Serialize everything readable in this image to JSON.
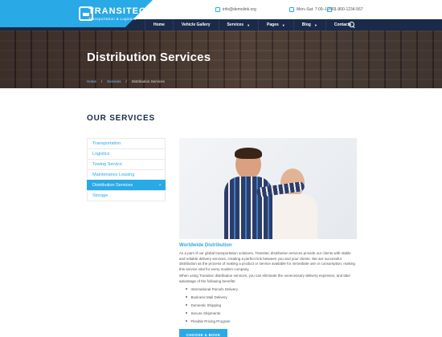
{
  "brand": {
    "name": "TRANSITEC",
    "tagline": "Transportation & Logistics",
    "accent_color": "#29a9e6",
    "nav_color": "#1a2a4a"
  },
  "contact": {
    "email": "info@demolink.org",
    "hours": "Mon–Sat: 7:00–19:00",
    "phone": "1-800-1234-567"
  },
  "nav": {
    "items": [
      {
        "label": "Home",
        "has_dropdown": false
      },
      {
        "label": "Vehicle Gallery",
        "has_dropdown": false
      },
      {
        "label": "Services",
        "has_dropdown": true
      },
      {
        "label": "Pages",
        "has_dropdown": true
      },
      {
        "label": "Blog",
        "has_dropdown": true
      },
      {
        "label": "Contacts",
        "has_dropdown": false
      }
    ],
    "search_icon": "search-icon"
  },
  "hero": {
    "title": "Distribution Services",
    "breadcrumb": [
      "Home",
      "Services",
      "Distribution Services"
    ]
  },
  "section": {
    "title": "OUR SERVICES"
  },
  "sidebar": {
    "items": [
      {
        "label": "Transportation",
        "active": false
      },
      {
        "label": "Logistics",
        "active": false
      },
      {
        "label": "Towing Service",
        "active": false
      },
      {
        "label": "Maintenance Leasing",
        "active": false
      },
      {
        "label": "Distribution Services",
        "active": true
      },
      {
        "label": "Storage",
        "active": false
      }
    ]
  },
  "content": {
    "subheading": "Worldwide Distribution",
    "paragraph1": "As a part of our global transportation solutions, Transitec distribution services provide our clients with stable and reliable delivery services, creating a perfect link between you and your clients. We are successful distribution as the process of making a product or service available for immediate use or consumption, making this service vital for every modern company.",
    "paragraph2": "When using Transitec distribution services, you can eliminate the unnecessary delivery expenses, and take advantage of the following benefits:",
    "benefits": [
      "International Parcels Delivery",
      "Business Mail Delivery",
      "Domestic Shipping",
      "Secure Shipments",
      "Flexible Pricing Program"
    ],
    "cta_label": "CHOOSE & BOOK"
  }
}
